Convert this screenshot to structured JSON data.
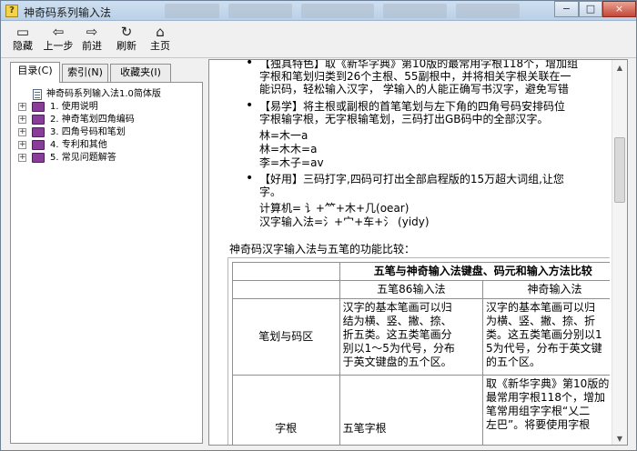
{
  "window": {
    "title": "神奇码系列输入法",
    "app_icon_glyph": "?",
    "controls": [
      "−",
      "□",
      "×"
    ]
  },
  "toolbar": {
    "buttons": [
      {
        "label": "隐藏",
        "icon": "hide-icon",
        "glyph": "▭"
      },
      {
        "label": "上一步",
        "icon": "back-arrow-icon",
        "glyph": "⇦"
      },
      {
        "label": "前进",
        "icon": "forward-arrow-icon",
        "glyph": "⇨"
      },
      {
        "label": "刷新",
        "icon": "refresh-icon",
        "glyph": "↻"
      },
      {
        "label": "主页",
        "icon": "home-icon",
        "glyph": "⌂"
      }
    ]
  },
  "nav": {
    "tabs": [
      "目录(C)",
      "索引(N)",
      "收藏夹(I)"
    ],
    "tree": [
      {
        "label": "神奇码系列输入法1.0简体版",
        "kind": "page",
        "expandable": false
      },
      {
        "label": "1. 使用说明",
        "kind": "book",
        "expandable": true
      },
      {
        "label": "2. 神奇笔划四角编码",
        "kind": "book",
        "expandable": true
      },
      {
        "label": "3. 四角号码和笔划",
        "kind": "book",
        "expandable": true
      },
      {
        "label": "4. 专利和其他",
        "kind": "book",
        "expandable": true
      },
      {
        "label": "5. 常见问题解答",
        "kind": "book",
        "expandable": true
      }
    ]
  },
  "doc": {
    "p1": {
      "lines": [
        "【独具特色】取《新华字典》第10版的最常用字根118个，增加组",
        "字根和笔划归类到26个主根、55副根中，并将相关字根关联在一",
        "能识码，轻松输入汉字， 学输入的人能正确写书汉字，避免写错"
      ]
    },
    "p2": {
      "lines": [
        "【易学】将主根或副根的首笔笔划与左下角的四角号码安排码位",
        "字根输字根，无字根输笔划，三码打出GB码中的全部汉字。"
      ]
    },
    "examples": [
      "林=木一a",
      "林=木木=a",
      "李=木子=av"
    ],
    "p3": {
      "lines": [
        "【好用】三码打字,四码可打出全部启程版的15万超大词组,让您",
        "字。"
      ]
    },
    "examples2": [
      "计算机= 讠+⺮+木+几(oear)",
      "汉字输入法=氵+宀+车+氵 (yidy)"
    ],
    "section_title": "神奇码汉字输入法与五笔的功能比较：",
    "table": {
      "title": "五笔与神奇输入法键盘、码元和输入方法比较",
      "col_headers": [
        "五笔86输入法",
        "神奇输入法"
      ],
      "rows": [
        {
          "label": "笔划与码区",
          "wubi": [
            "汉字的基本笔画可以归",
            "结为横、竖、撇、捺、",
            "折五类。这五类笔画分",
            "别以1～5为代号，分布",
            "于英文键盘的五个区。"
          ],
          "shenqi": [
            "汉字的基本笔画可以归",
            "为横、竖、撇、捺、折",
            "类。这五类笔画分别以1",
            "5为代号，分布于英文键",
            "的五个区。"
          ]
        },
        {
          "label": "字根",
          "wubi": [
            "五笔字根"
          ],
          "shenqi": [
            "取《新华字典》第10版的",
            "最常用字根118个，增加",
            "笔常用组字字根“乂二",
            "左巴”。将要使用字根"
          ]
        }
      ]
    }
  }
}
